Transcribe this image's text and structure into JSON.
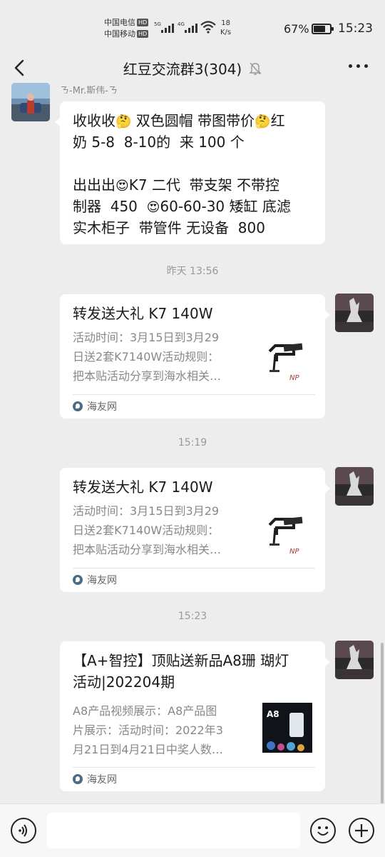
{
  "status_bar": {
    "carrier_1": "中国电信",
    "carrier_2": "中国移动",
    "hd_badge": "HD",
    "signal_1_label": "5G",
    "signal_2_label": "4G",
    "net_speed_value": "18",
    "net_speed_unit": "K/s",
    "battery_percent": "67%",
    "battery_level": 0.67,
    "time": "15:23"
  },
  "header": {
    "title": "红豆交流群3(304)",
    "icons": [
      "back-arrow-icon",
      "mute-bell-icon",
      "more-icon"
    ]
  },
  "messages": {
    "first": {
      "sender": "ㄋ-Mr.斯伟-ㄋ",
      "line_1": "收收收",
      "line_1_b": " 双色圆帽 带图带价",
      "line_1_c": "红",
      "line_2": "奶 5-8  8-10的  来 100 个",
      "line_3": "出出出",
      "line_3_b": "K7 二代  带支架 不带控",
      "line_4": "制器  450  ",
      "line_4_b": "60-60-30 矮缸 底滤",
      "line_5": "实木柜子  带管件 无设备  800",
      "emoji_thinking": "🤔",
      "emoji_love": "😍"
    },
    "timestamp_1": "昨天 13:56",
    "card_1": {
      "title": "转发送大礼  K7 140W",
      "desc_1": "活动时间：3月15日到3月29",
      "desc_2": "日送2套K7140W活动规则：",
      "desc_3": "把本贴活动分享到海水相关…",
      "source": "海友网"
    },
    "timestamp_2": "15:19",
    "card_2": {
      "title": "转发送大礼  K7 140W",
      "desc_1": "活动时间：3月15日到3月29",
      "desc_2": "日送2套K7140W活动规则：",
      "desc_3": "把本贴活动分享到海水相关…",
      "source": "海友网"
    },
    "timestamp_3": "15:23",
    "card_3": {
      "title_1": "【A+智控】顶贴送新品A8珊 瑚灯",
      "title_2": "活动|202204期",
      "desc_1": "A8产品视频展示：A8产品图",
      "desc_2": "片展示：活动时间：2022年3",
      "desc_3": "月21日到4月21日中奖人数…",
      "thumb_label": "A8",
      "source": "海友网"
    }
  },
  "input_bar": {
    "icons": [
      "voice-icon",
      "emoji-icon",
      "plus-icon"
    ],
    "text_value": ""
  }
}
